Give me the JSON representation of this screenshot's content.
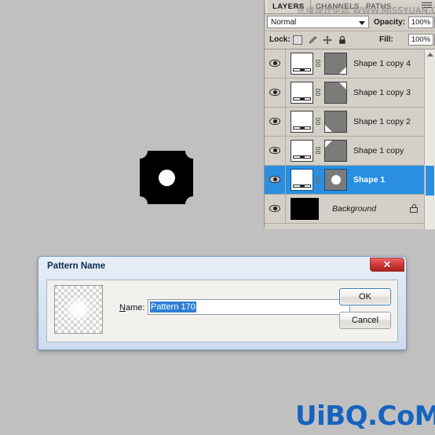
{
  "app": {
    "background_color": "#c0c0c0"
  },
  "canvas": {
    "artwork_name": "black-rounded-square-with-white-dot"
  },
  "layers_panel": {
    "tabs": [
      {
        "label": "LAYERS",
        "active": true
      },
      {
        "label": "CHANNELS",
        "active": false
      },
      {
        "label": "PATHS",
        "active": false
      }
    ],
    "blend_mode": "Normal",
    "opacity_label": "Opacity:",
    "opacity_value": "100%",
    "lock_label": "Lock:",
    "fill_label": "Fill:",
    "fill_value": "100%",
    "lock_icons": [
      "checkerboard-icon",
      "brush-icon",
      "move-icon",
      "lock-icon"
    ],
    "layers": [
      {
        "name": "Shape 1 copy 4",
        "selected": false,
        "type": "shape",
        "visible": true
      },
      {
        "name": "Shape 1 copy 3",
        "selected": false,
        "type": "shape",
        "visible": true
      },
      {
        "name": "Shape 1 copy 2",
        "selected": false,
        "type": "shape",
        "visible": true
      },
      {
        "name": "Shape 1 copy",
        "selected": false,
        "type": "shape",
        "visible": true
      },
      {
        "name": "Shape 1",
        "selected": true,
        "type": "shape",
        "visible": true
      },
      {
        "name": "Background",
        "selected": false,
        "type": "background",
        "visible": true,
        "locked": true
      }
    ]
  },
  "dialog": {
    "title": "Pattern Name",
    "close_label": "✕",
    "name_label_prefix": "",
    "name_label_underlined": "N",
    "name_label_rest": "ame:",
    "name_value": "Pattern 170",
    "ok_label": "OK",
    "cancel_label": "Cancel",
    "preview_name": "pattern-preview-thumbnail"
  },
  "watermarks": {
    "panel": "思缘设计论坛 WWW.MISSYUAN.COM",
    "bottom": "UiBQ.CoM",
    "bottom_color": "#1663c0"
  }
}
